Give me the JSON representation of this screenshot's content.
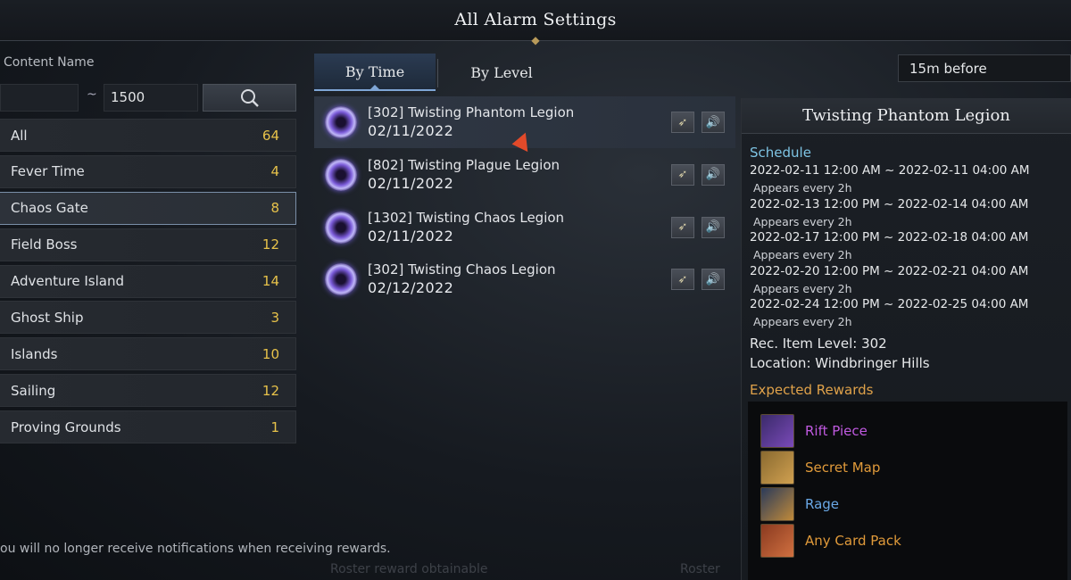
{
  "window": {
    "title": "All Alarm Settings"
  },
  "filter": {
    "content_name_label": "Content Name",
    "range_separator": "~",
    "range_max": "1500"
  },
  "categories": [
    {
      "label": "All",
      "count": "64"
    },
    {
      "label": "Fever Time",
      "count": "4"
    },
    {
      "label": "Chaos Gate",
      "count": "8"
    },
    {
      "label": "Field Boss",
      "count": "12"
    },
    {
      "label": "Adventure Island",
      "count": "14"
    },
    {
      "label": "Ghost Ship",
      "count": "3"
    },
    {
      "label": "Islands",
      "count": "10"
    },
    {
      "label": "Sailing",
      "count": "12"
    },
    {
      "label": "Proving Grounds",
      "count": "1"
    }
  ],
  "tabs": [
    {
      "label": "By Time"
    },
    {
      "label": "By Level"
    }
  ],
  "alarms": [
    {
      "name": "[302] Twisting Phantom Legion",
      "date": "02/11/2022"
    },
    {
      "name": "[802] Twisting Plague Legion",
      "date": "02/11/2022"
    },
    {
      "name": "[1302] Twisting Chaos Legion",
      "date": "02/11/2022"
    },
    {
      "name": "[302] Twisting Chaos Legion",
      "date": "02/12/2022"
    }
  ],
  "notify_dropdown": {
    "selected": "15m before"
  },
  "detail": {
    "title": "Twisting Phantom Legion",
    "schedule_label": "Schedule",
    "schedule": [
      {
        "range": "2022-02-11 12:00 AM ~ 2022-02-11 04:00 AM",
        "note": "Appears every 2h"
      },
      {
        "range": "2022-02-13 12:00 PM ~ 2022-02-14 04:00 AM",
        "note": "Appears every 2h"
      },
      {
        "range": "2022-02-17 12:00 PM ~ 2022-02-18 04:00 AM",
        "note": "Appears every 2h"
      },
      {
        "range": "2022-02-20 12:00 PM ~ 2022-02-21 04:00 AM",
        "note": "Appears every 2h"
      },
      {
        "range": "2022-02-24 12:00 PM ~ 2022-02-25 04:00 AM",
        "note": "Appears every 2h"
      }
    ],
    "rec_item_level": "Rec. Item Level: 302",
    "location": "Location: Windbringer Hills",
    "rewards_label": "Expected Rewards",
    "rewards": [
      {
        "name": "Rift Piece",
        "color": "#c05ae0",
        "icon": "rift-piece-icon"
      },
      {
        "name": "Secret Map",
        "color": "#e09a3a",
        "icon": "secret-map-icon"
      },
      {
        "name": "Rage",
        "color": "#6aa8e6",
        "icon": "rage-icon"
      },
      {
        "name": "Any Card Pack",
        "color": "#e09a3a",
        "icon": "card-pack-icon"
      }
    ]
  },
  "footer": {
    "note": "ou will no longer receive notifications when receiving rewards.",
    "ghost_1": "Roster reward obtainable",
    "ghost_2": "Roster"
  },
  "colors": {
    "accent_blue": "#7fa6d6",
    "count_yellow": "#e7c24a",
    "schedule_cyan": "#7ec4e4",
    "reward_orange": "#e0a24a"
  }
}
